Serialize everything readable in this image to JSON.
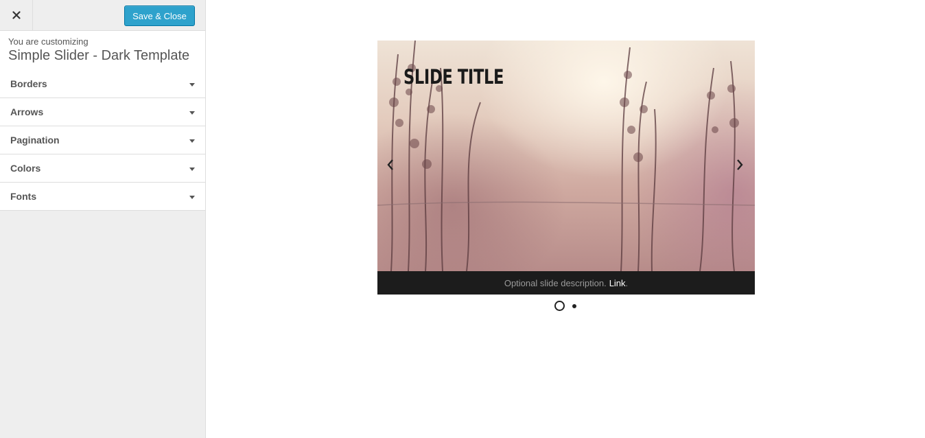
{
  "sidebar": {
    "close_icon": "close-icon",
    "save_label": "Save & Close",
    "customizing_label": "You are customizing",
    "template_title": "Simple Slider - Dark Template",
    "sections": [
      {
        "label": "Borders"
      },
      {
        "label": "Arrows"
      },
      {
        "label": "Pagination"
      },
      {
        "label": "Colors"
      },
      {
        "label": "Fonts"
      }
    ]
  },
  "preview": {
    "slide_title": "SLIDE TITLE",
    "description": "Optional slide description.",
    "link_text": "Link",
    "link_suffix": ".",
    "prev_icon": "chevron-left-icon",
    "next_icon": "chevron-right-icon",
    "pagination": {
      "count": 2,
      "active": 1
    }
  },
  "colors": {
    "save_button": "#2ea2cc",
    "caption_bar": "#1c1c1c",
    "sidebar_bg": "#eeeeee"
  }
}
